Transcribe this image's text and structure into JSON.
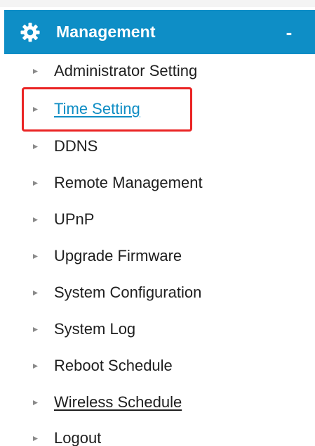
{
  "header": {
    "title": "Management",
    "collapse_symbol": "-",
    "icon": "gear-icon",
    "background": "#0e8ec6"
  },
  "menu": {
    "bullet_icon": "arrow-bullet-icon",
    "active_color": "#0f8dc4",
    "highlight_color": "#ea2424",
    "items": [
      {
        "label": "Administrator Setting",
        "name": "menu-item-administrator-setting",
        "active": false,
        "underlined": false
      },
      {
        "label": "Time Setting",
        "name": "menu-item-time-setting",
        "active": true,
        "underlined": true,
        "highlighted": true
      },
      {
        "label": "DDNS",
        "name": "menu-item-ddns",
        "active": false,
        "underlined": false
      },
      {
        "label": "Remote Management",
        "name": "menu-item-remote-management",
        "active": false,
        "underlined": false
      },
      {
        "label": "UPnP",
        "name": "menu-item-upnp",
        "active": false,
        "underlined": false
      },
      {
        "label": "Upgrade Firmware",
        "name": "menu-item-upgrade-firmware",
        "active": false,
        "underlined": false
      },
      {
        "label": "System Configuration",
        "name": "menu-item-system-configuration",
        "active": false,
        "underlined": false
      },
      {
        "label": "System Log",
        "name": "menu-item-system-log",
        "active": false,
        "underlined": false
      },
      {
        "label": "Reboot Schedule",
        "name": "menu-item-reboot-schedule",
        "active": false,
        "underlined": false
      },
      {
        "label": "Wireless Schedule",
        "name": "menu-item-wireless-schedule",
        "active": false,
        "underlined": true
      },
      {
        "label": "Logout",
        "name": "menu-item-logout",
        "active": false,
        "underlined": false
      }
    ]
  }
}
